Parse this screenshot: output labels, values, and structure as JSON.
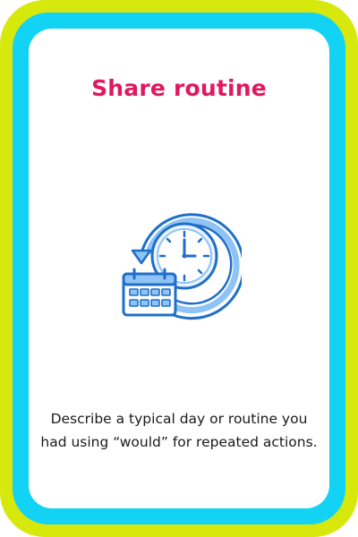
{
  "card": {
    "title": "Share routine",
    "description": "Describe a typical day or routine you had using “would” for repeated actions.",
    "icon": "clock-calendar-cycle-icon",
    "colors": {
      "outer_border": "#d7e80c",
      "inner_border": "#12d3f3",
      "title": "#e0185f",
      "icon_blue": "#1f6fc9",
      "icon_light": "#8fc3f5"
    }
  }
}
